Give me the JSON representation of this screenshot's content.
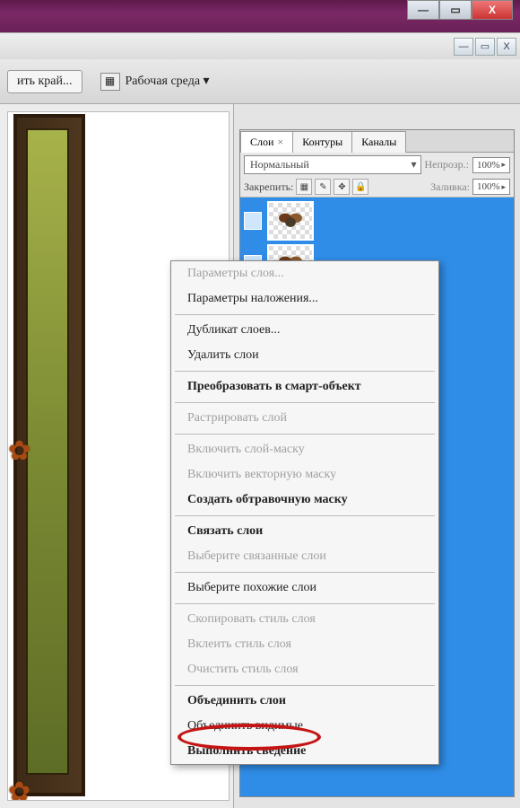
{
  "window": {
    "minimize": "—",
    "maximize": "▭",
    "close": "X",
    "inner_minimize": "—",
    "inner_maximize": "▭",
    "inner_x": "X"
  },
  "options_bar": {
    "refine_edge": "ить край...",
    "workspace_label": "Рабочая среда ▾"
  },
  "layers_panel": {
    "tabs": {
      "layers": "Слои",
      "paths": "Контуры",
      "channels": "Каналы"
    },
    "blend_mode": "Нормальный",
    "opacity_label": "Непрозр.:",
    "opacity_value": "100%",
    "lock_label": "Закрепить:",
    "fill_label": "Заливка:",
    "fill_value": "100%"
  },
  "context_menu": {
    "items": [
      {
        "label": "Параметры слоя...",
        "disabled": true
      },
      {
        "label": "Параметры наложения...",
        "disabled": false
      },
      {
        "sep": true
      },
      {
        "label": "Дубликат слоев...",
        "disabled": false
      },
      {
        "label": "Удалить слои",
        "disabled": false
      },
      {
        "sep": true
      },
      {
        "label": "Преобразовать в смарт-объект",
        "bold": true
      },
      {
        "sep": true
      },
      {
        "label": "Растрировать слой",
        "disabled": true
      },
      {
        "sep": true
      },
      {
        "label": "Включить слой-маску",
        "disabled": true
      },
      {
        "label": "Включить векторную маску",
        "disabled": true
      },
      {
        "label": "Создать обтравочную маску",
        "bold": true
      },
      {
        "sep": true
      },
      {
        "label": "Связать слои",
        "bold": true
      },
      {
        "label": "Выберите связанные слои",
        "disabled": true
      },
      {
        "sep": true
      },
      {
        "label": "Выберите похожие слои",
        "disabled": false
      },
      {
        "sep": true
      },
      {
        "label": "Скопировать стиль слоя",
        "disabled": true
      },
      {
        "label": "Вклеить стиль слоя",
        "disabled": true
      },
      {
        "label": "Очистить стиль слоя",
        "disabled": true
      },
      {
        "sep": true
      },
      {
        "label": "Объединить слои",
        "bold": true,
        "highlight": true
      },
      {
        "label": "Объединить видимые",
        "disabled": false
      },
      {
        "label": "Выполнить сведение",
        "bold": true
      }
    ]
  }
}
